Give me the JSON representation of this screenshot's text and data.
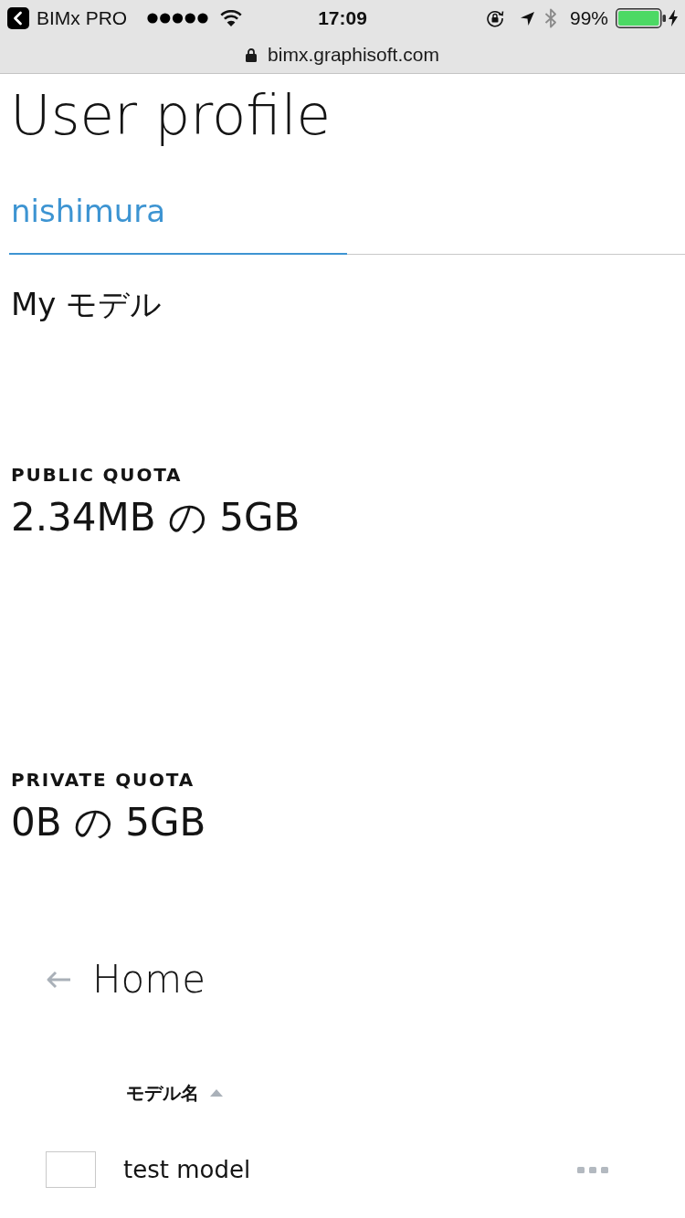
{
  "status_bar": {
    "back_app": "BIMx PRO",
    "time": "17:09",
    "battery_percent": "99%"
  },
  "address_bar": {
    "url": "bimx.graphisoft.com"
  },
  "page": {
    "title": "User profile"
  },
  "tabs": [
    {
      "label": "nishimura",
      "selected": true
    }
  ],
  "section_title": "My モデル",
  "quotas": [
    {
      "label": "PUBLIC QUOTA",
      "value": "2.34MB の 5GB"
    },
    {
      "label": "PRIVATE QUOTA",
      "value": "0B の 5GB"
    }
  ],
  "breadcrumb": {
    "label": "Home"
  },
  "table": {
    "columns": [
      {
        "label": "モデル名",
        "sort_ascending": true
      }
    ],
    "rows": [
      {
        "name": "test model"
      }
    ]
  }
}
